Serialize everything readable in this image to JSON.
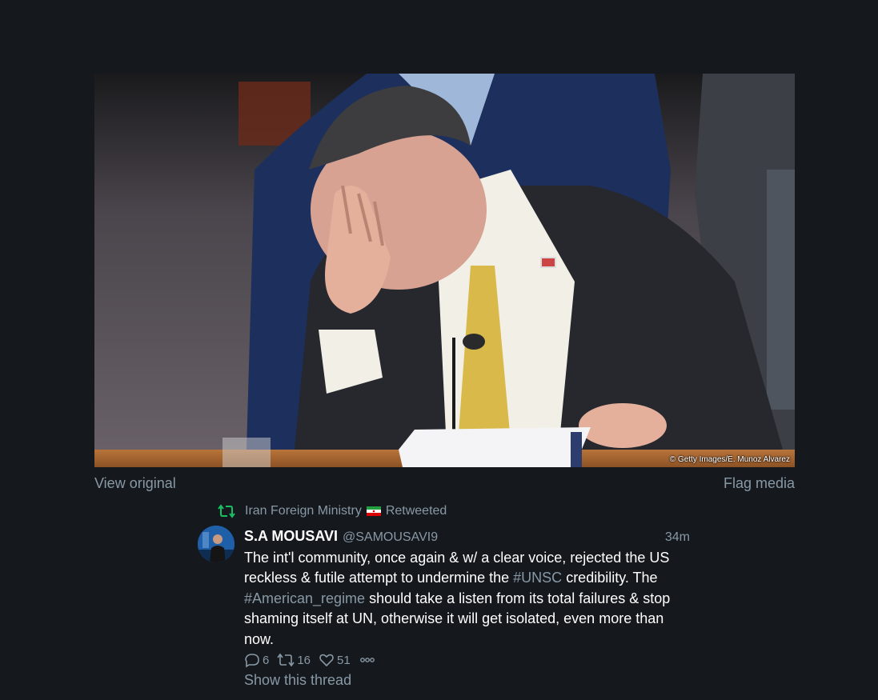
{
  "media": {
    "credit": "© Getty Images/E. Munoz Alvarez",
    "view_original": "View original",
    "flag_media": "Flag media"
  },
  "retweet": {
    "retweeter": "Iran Foreign Ministry",
    "flag_icon": "iran-flag-icon",
    "label": "Retweeted"
  },
  "tweet": {
    "display_name": "S.A MOUSAVI",
    "handle": "@SAMOUSAVI9",
    "time": "34m",
    "text": {
      "part1": "The int'l community, once again & w/ a clear voice, rejected the US reckless & futile attempt to undermine the ",
      "hashtag1": "#UNSC",
      "part2": " credibility. The ",
      "hashtag2": "#American_regime",
      "part3": " should take a listen from its total failures & stop shaming itself at UN, otherwise it will get isolated, even more than now."
    },
    "actions": {
      "replies": "6",
      "retweets": "16",
      "likes": "51"
    },
    "show_thread": "Show this thread"
  },
  "colors": {
    "background": "#15181c",
    "muted_text": "#8899a6",
    "retweet_green": "#17bf63"
  }
}
